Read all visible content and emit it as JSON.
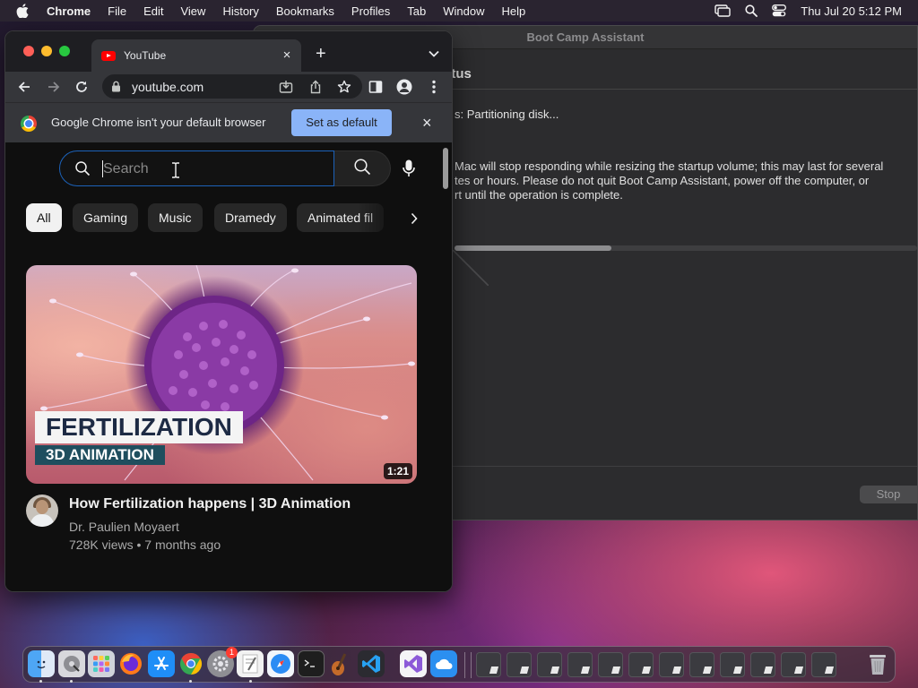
{
  "menubar": {
    "app_name": "Chrome",
    "items": [
      "File",
      "Edit",
      "View",
      "History",
      "Bookmarks",
      "Profiles",
      "Tab",
      "Window",
      "Help"
    ],
    "clock": "Thu Jul 20  5:12 PM"
  },
  "bootcamp": {
    "window_title": "Boot Camp Assistant",
    "heading_partial": "atus",
    "status_text": "s: Partitioning disk...",
    "warning_lines": [
      "Mac will stop responding while resizing the startup volume; this may last for several",
      "tes or hours. Please do not quit Boot Camp Assistant, power off the computer, or",
      "rt until the operation is complete."
    ],
    "progress_fraction": 0.34,
    "stop_label": "Stop"
  },
  "chrome": {
    "tab": {
      "title": "YouTube",
      "close": "×"
    },
    "new_tab": "+",
    "url": "youtube.com",
    "infobar": {
      "message": "Google Chrome isn't your default browser",
      "button": "Set as default",
      "close": "×"
    }
  },
  "youtube": {
    "search_placeholder": "Search",
    "chips": [
      "All",
      "Gaming",
      "Music",
      "Dramedy",
      "Animated fil"
    ],
    "video": {
      "thumbnail_line1": "FERTILIZATION",
      "thumbnail_line2": "3D ANIMATION",
      "duration": "1:21",
      "title": "How Fertilization happens | 3D Animation",
      "channel": "Dr. Paulien Moyaert",
      "meta": "728K views • 7 months ago"
    }
  },
  "dock": {
    "apps": [
      "finder-icon",
      "disk-utility-icon",
      "launchpad-icon",
      "firefox-icon",
      "app-store-icon",
      "chrome-icon",
      "system-settings-icon",
      "textedit-icon",
      "safari-icon",
      "terminal-icon",
      "garageband-icon",
      "vscode-icon",
      "visual-studio-icon",
      "icloud-icon"
    ],
    "settings_badge": "1",
    "minimized_windows": 12
  }
}
